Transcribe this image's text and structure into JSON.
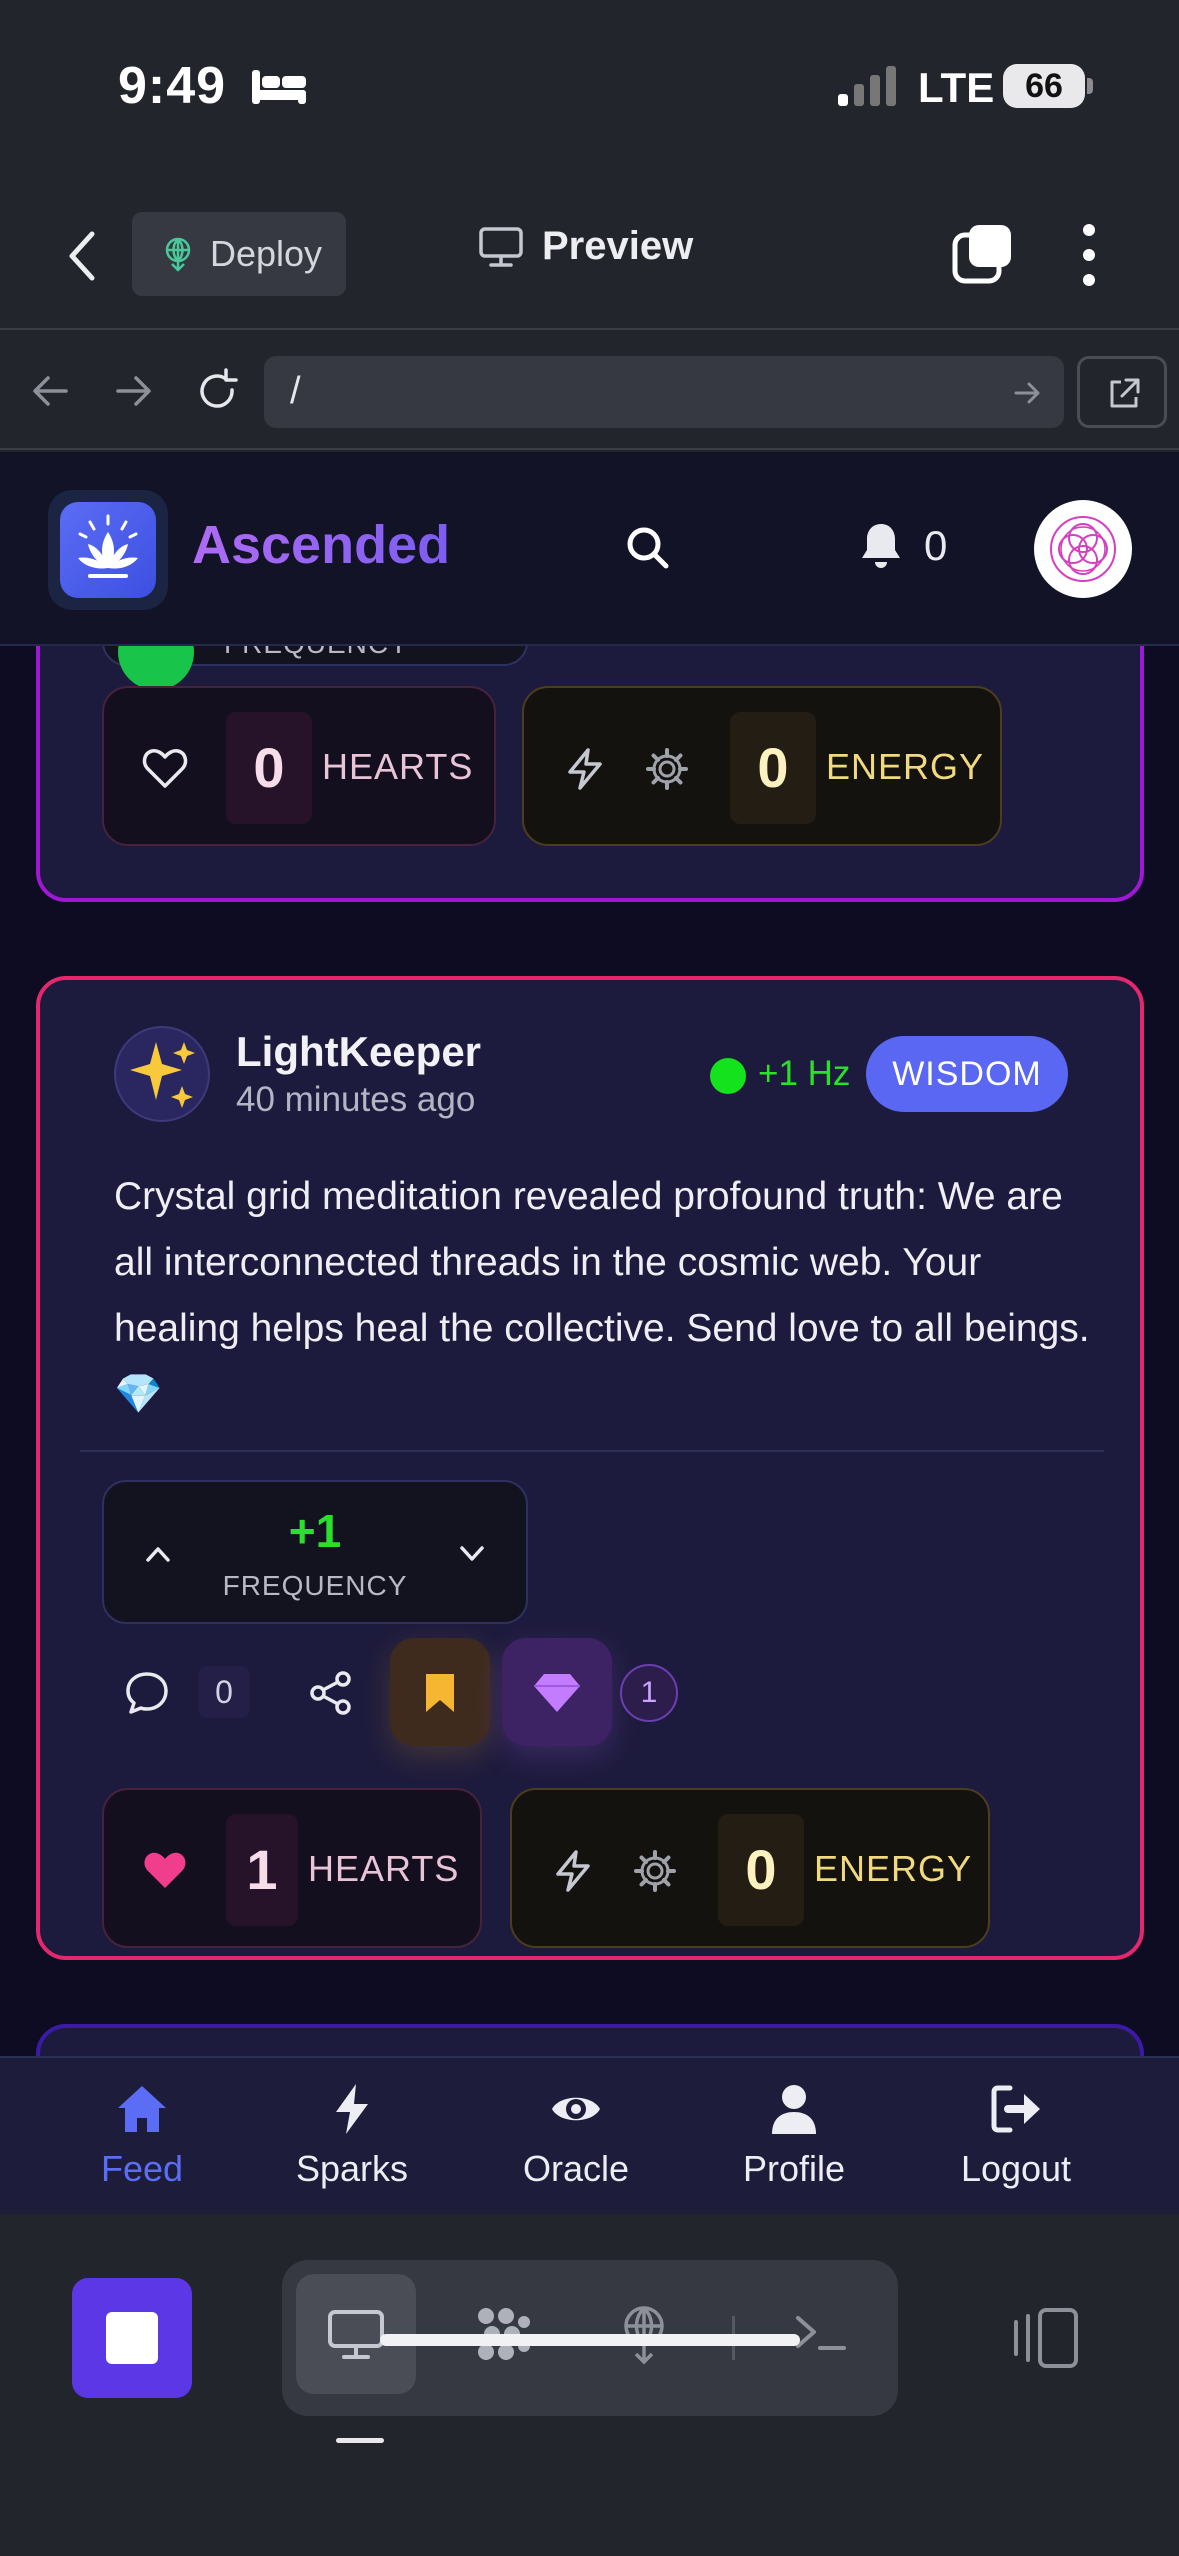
{
  "status_bar": {
    "time": "9:49",
    "network": "LTE",
    "battery": "66"
  },
  "toolbar": {
    "deploy_label": "Deploy",
    "preview_label": "Preview"
  },
  "url_bar": {
    "path": "/"
  },
  "app": {
    "brand": "Ascended",
    "notification_count": "0",
    "colors": {
      "accent": "#5b6df5",
      "brand_gradient": [
        "#b06bf5",
        "#7b5df0"
      ]
    }
  },
  "prev_post": {
    "frequency_label": "FREQUENCY",
    "hearts_count": "0",
    "hearts_label": "HEARTS",
    "energy_count": "0",
    "energy_label": "ENERGY",
    "border_color": "#a117d6"
  },
  "post": {
    "author": "LightKeeper",
    "time_ago": "40 minutes ago",
    "hz": "+1 Hz",
    "tag": "WISDOM",
    "body": "Crystal grid meditation revealed profound truth: We are all interconnected threads in the cosmic web. Your healing helps heal the collective. Send love to all beings. 💎",
    "frequency_value": "+1",
    "frequency_label": "FREQUENCY",
    "comment_count": "0",
    "gem_count": "1",
    "hearts_count": "1",
    "hearts_label": "HEARTS",
    "energy_count": "0",
    "energy_label": "ENERGY",
    "border_color": "#e5286e"
  },
  "bottom_nav": {
    "items": [
      {
        "label": "Feed",
        "icon": "home-icon",
        "active": true
      },
      {
        "label": "Sparks",
        "icon": "bolt-icon"
      },
      {
        "label": "Oracle",
        "icon": "eye-icon"
      },
      {
        "label": "Profile",
        "icon": "user-icon"
      },
      {
        "label": "Logout",
        "icon": "logout-icon"
      }
    ]
  }
}
